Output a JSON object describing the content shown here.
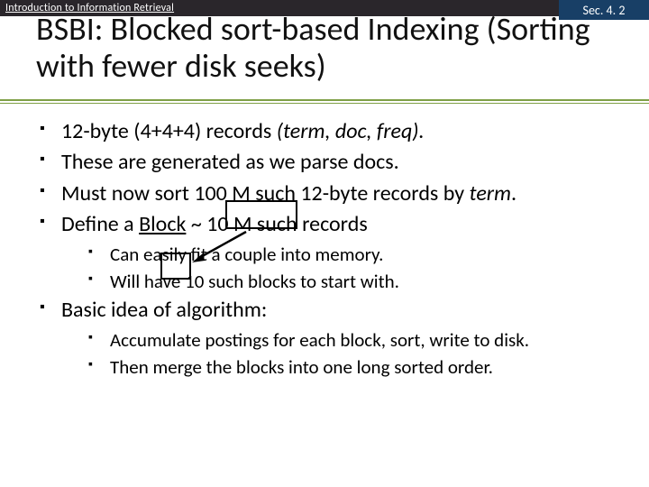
{
  "topbar": {
    "left": "Introduction to Information Retrieval",
    "right": "Sec. 4. 2"
  },
  "title": "BSBI: Blocked sort-based Indexing (Sorting with fewer disk seeks)",
  "bullets": {
    "b1_a": "12-byte (4+4+4) records ",
    "b1_b": "(term, doc, freq).",
    "b2": "These are generated as we parse docs.",
    "b3_a": "Must now sort 100 M such 12-byte records by ",
    "b3_b": "term",
    "b3_c": ".",
    "b4_a": "Define a ",
    "b4_b": "Block",
    "b4_c": " ~ 10 M such records",
    "b4s1": "Can easily fit a couple into memory.",
    "b4s2": "Will have 10 such blocks to start with.",
    "b5": "Basic idea of algorithm:",
    "b5s1": "Accumulate postings for each block, sort, write to disk.",
    "b5s2": "Then merge the blocks into one long sorted order."
  }
}
